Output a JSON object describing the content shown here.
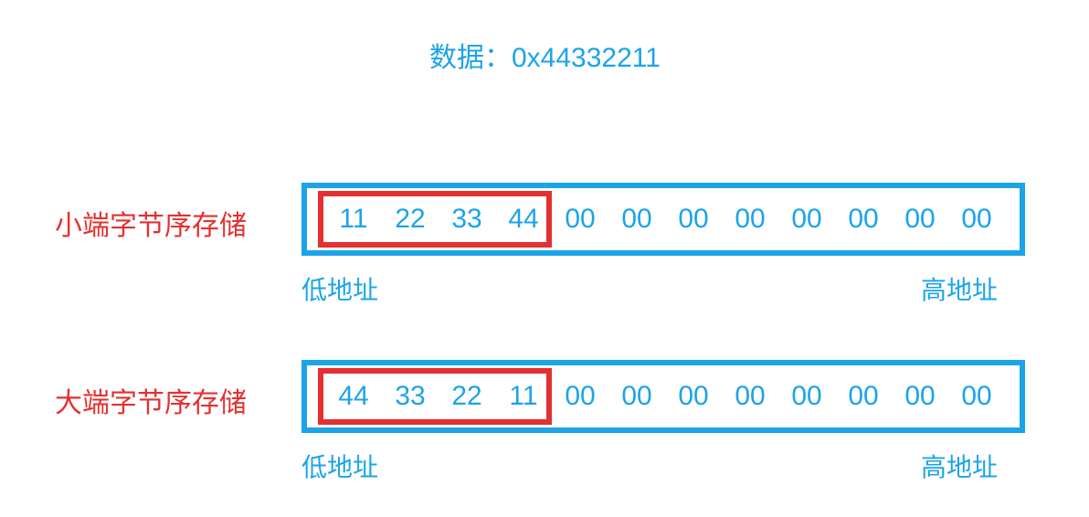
{
  "title": "数据：0x44332211",
  "rows": [
    {
      "label": "小端字节序存储",
      "bytes": [
        "11",
        "22",
        "33",
        "44",
        "00",
        "00",
        "00",
        "00",
        "00",
        "00",
        "00",
        "00"
      ],
      "low_addr": "低地址",
      "high_addr": "高地址"
    },
    {
      "label": "大端字节序存储",
      "bytes": [
        "44",
        "33",
        "22",
        "11",
        "00",
        "00",
        "00",
        "00",
        "00",
        "00",
        "00",
        "00"
      ],
      "low_addr": "低地址",
      "high_addr": "高地址"
    }
  ]
}
